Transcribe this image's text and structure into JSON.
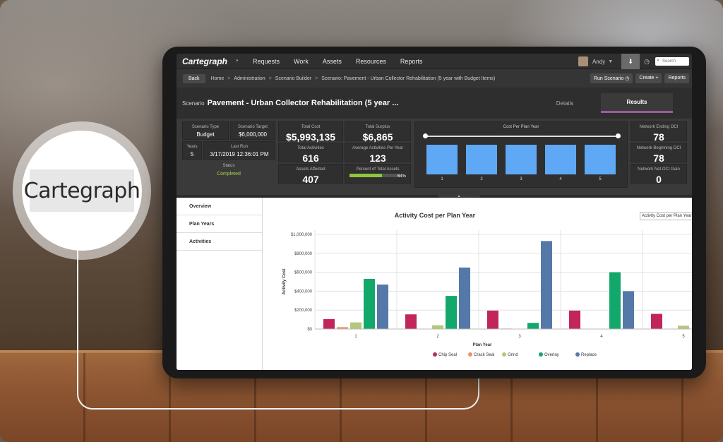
{
  "logo": {
    "text": "Cartegraph"
  },
  "app": {
    "brand": "Cartegraph",
    "nav": [
      "Requests",
      "Work",
      "Assets",
      "Resources",
      "Reports"
    ],
    "user": "Andy",
    "search_placeholder": "Search"
  },
  "breadcrumb": {
    "back": "Back",
    "items": [
      "Home",
      "Administration",
      "Scenario Builder",
      "Scenario: Pavement - Urban Collector Rehabilitation (5 year with Budget Items)"
    ],
    "actions": [
      "Run Scenario",
      "Create",
      "Reports"
    ]
  },
  "scenario": {
    "label": "Scenario",
    "title": "Pavement - Urban Collector Rehabilitation (5 year ...",
    "tabs": [
      "Details",
      "Results"
    ],
    "active_tab": "Results"
  },
  "stats": {
    "scenario_type_label": "Scenario Type",
    "scenario_type": "Budget",
    "scenario_target_label": "Scenario Target",
    "scenario_target": "$6,000,000",
    "years_label": "Years",
    "years": "5",
    "last_run_label": "Last Run",
    "last_run": "3/17/2019 12:36:01 PM",
    "status_label": "Status",
    "status": "Completed",
    "total_cost_label": "Total Cost",
    "total_cost": "$5,993,135",
    "total_surplus_label": "Total Surplus",
    "total_surplus": "$6,865",
    "total_activities_label": "Total Activities",
    "total_activities": "616",
    "avg_activities_label": "Average Activities Per Year",
    "avg_activities": "123",
    "assets_affected_label": "Assets Affected",
    "assets_affected": "407",
    "percent_assets_label": "Percent of Total Assets",
    "percent_assets": "64%",
    "percent_assets_value": 0.64,
    "ending_oci_label": "Network Ending OCI",
    "ending_oci": "78",
    "beginning_oci_label": "Network Beginning OCI",
    "beginning_oci": "78",
    "net_oci_label": "Network Net OCI Gain",
    "net_oci": "0"
  },
  "mini_chart": {
    "title": "Cost Per Plan Year",
    "categories": [
      "1",
      "2",
      "3",
      "4",
      "5"
    ],
    "values": [
      1,
      1,
      1,
      1,
      1
    ],
    "color": "#5ea8f5"
  },
  "left_nav": [
    "Overview",
    "Plan Years",
    "Activities"
  ],
  "chart_select": "Activity Cost per Plan Year",
  "chart_data": {
    "type": "bar",
    "title": "Activity Cost per Plan Year",
    "xlabel": "Plan Year",
    "ylabel": "Activity Cost",
    "categories": [
      "1",
      "2",
      "3",
      "4",
      "5"
    ],
    "ylim": [
      0,
      1000000
    ],
    "yticks": [
      "$0",
      "$200,000",
      "$400,000",
      "$600,000",
      "$800,000",
      "$1,000,000"
    ],
    "grid": true,
    "legend_position": "bottom",
    "series": [
      {
        "name": "Chip Seal",
        "color": "#c2255c",
        "values": [
          105000,
          155000,
          195000,
          195000,
          160000
        ]
      },
      {
        "name": "Crack Seal",
        "color": "#e8956b",
        "values": [
          20000,
          0,
          5000,
          0,
          0
        ]
      },
      {
        "name": "Grind",
        "color": "#b5c77a",
        "values": [
          70000,
          40000,
          0,
          0,
          35000
        ]
      },
      {
        "name": "Overlay",
        "color": "#12a86b",
        "values": [
          530000,
          350000,
          65000,
          600000,
          0
        ]
      },
      {
        "name": "Replace",
        "color": "#5478a8",
        "values": [
          470000,
          650000,
          930000,
          400000,
          0
        ]
      }
    ]
  }
}
